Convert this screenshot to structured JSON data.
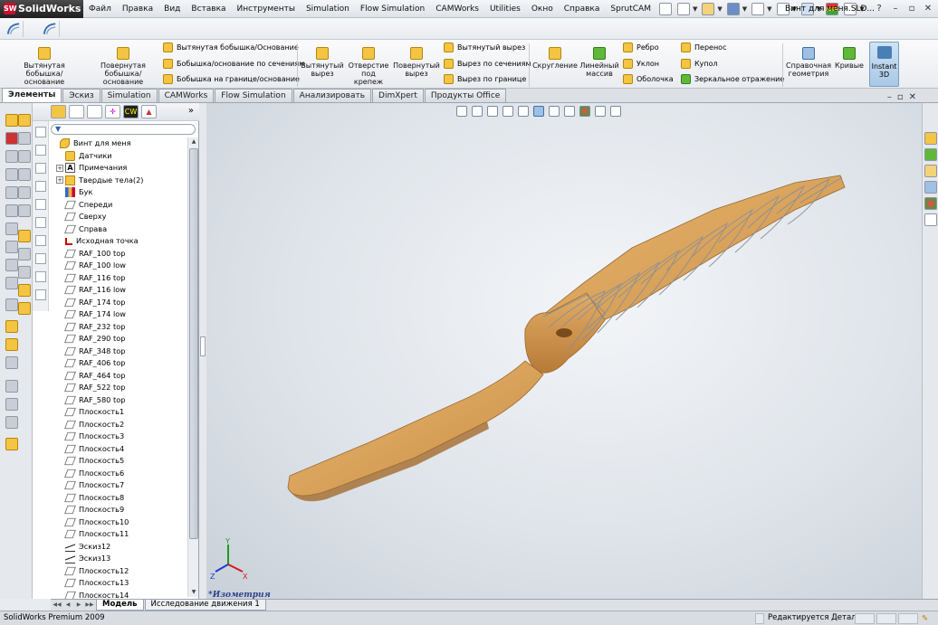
{
  "app": {
    "brand": "SolidWorks",
    "logo_mark": "SW"
  },
  "menu": [
    "Файл",
    "Правка",
    "Вид",
    "Вставка",
    "Инструменты",
    "Simulation",
    "Flow Simulation",
    "CAMWorks",
    "Utilities",
    "Окно",
    "Справка",
    "SprutCAM"
  ],
  "document_title": "Винт для меня.SLD...",
  "ribbon": {
    "boss_extrude": "Вытянутая бобышка/основание",
    "boss_revolve": "Повернутая бобышка/основание",
    "swept_boss": "Вытянутая бобышка/Основание",
    "lofted_boss": "Бобышка/основание по сечениям",
    "boundary_boss": "Бобышка на границе/основание",
    "cut_extrude": "Вытянутый вырез",
    "hole_wizard": "Отверстие под крепеж",
    "cut_revolve": "Повернутый вырез",
    "swept_cut": "Вытянутый вырез",
    "lofted_cut": "Вырез по сечениям",
    "boundary_cut": "Вырез по границе",
    "fillet": "Скругление",
    "linear_pattern": "Линейный массив",
    "rib": "Ребро",
    "draft": "Уклон",
    "shell": "Оболочка",
    "wrap": "Перенос",
    "dome": "Купол",
    "mirror": "Зеркальное отражение",
    "ref_geometry": "Справочная геометрия",
    "curves": "Кривые",
    "instant3d": "Instant 3D"
  },
  "tabs": [
    {
      "label": "Элементы",
      "active": true
    },
    {
      "label": "Эскиз",
      "active": false
    },
    {
      "label": "Simulation",
      "active": false
    },
    {
      "label": "CAMWorks",
      "active": false
    },
    {
      "label": "Flow Simulation",
      "active": false
    },
    {
      "label": "Анализировать",
      "active": false
    },
    {
      "label": "DimXpert",
      "active": false
    },
    {
      "label": "Продукты Office",
      "active": false
    }
  ],
  "feature_tree": [
    {
      "label": "Винт для меня",
      "icon": "part-icon",
      "indent": 0,
      "expand": ""
    },
    {
      "label": "Датчики",
      "icon": "sensor-icon",
      "indent": 1,
      "expand": ""
    },
    {
      "label": "Примечания",
      "icon": "note-icon",
      "indent": 1,
      "expand": "+"
    },
    {
      "label": "Твердые тела(2)",
      "icon": "solid-bodies-icon",
      "indent": 1,
      "expand": "+"
    },
    {
      "label": "Бук",
      "icon": "material-icon",
      "indent": 1,
      "expand": ""
    },
    {
      "label": "Спереди",
      "icon": "plane-icon",
      "indent": 1,
      "expand": ""
    },
    {
      "label": "Сверху",
      "icon": "plane-icon",
      "indent": 1,
      "expand": ""
    },
    {
      "label": "Справа",
      "icon": "plane-icon",
      "indent": 1,
      "expand": ""
    },
    {
      "label": "Исходная точка",
      "icon": "origin-icon",
      "indent": 1,
      "expand": ""
    },
    {
      "label": "RAF_100 top",
      "icon": "plane-icon",
      "indent": 1,
      "expand": ""
    },
    {
      "label": "RAF_100 low",
      "icon": "plane-icon",
      "indent": 1,
      "expand": ""
    },
    {
      "label": "RAF_116 top",
      "icon": "plane-icon",
      "indent": 1,
      "expand": ""
    },
    {
      "label": "RAF_116 low",
      "icon": "plane-icon",
      "indent": 1,
      "expand": ""
    },
    {
      "label": "RAF_174 top",
      "icon": "plane-icon",
      "indent": 1,
      "expand": ""
    },
    {
      "label": "RAF_174 low",
      "icon": "plane-icon",
      "indent": 1,
      "expand": ""
    },
    {
      "label": "RAF_232 top",
      "icon": "plane-icon",
      "indent": 1,
      "expand": ""
    },
    {
      "label": "RAF_290 top",
      "icon": "plane-icon",
      "indent": 1,
      "expand": ""
    },
    {
      "label": "RAF_348 top",
      "icon": "plane-icon",
      "indent": 1,
      "expand": ""
    },
    {
      "label": "RAF_406 top",
      "icon": "plane-icon",
      "indent": 1,
      "expand": ""
    },
    {
      "label": "RAF_464 top",
      "icon": "plane-icon",
      "indent": 1,
      "expand": ""
    },
    {
      "label": "RAF_522 top",
      "icon": "plane-icon",
      "indent": 1,
      "expand": ""
    },
    {
      "label": "RAF_580 top",
      "icon": "plane-icon",
      "indent": 1,
      "expand": ""
    },
    {
      "label": "Плоскость1",
      "icon": "plane-icon",
      "indent": 1,
      "expand": ""
    },
    {
      "label": "Плоскость2",
      "icon": "plane-icon",
      "indent": 1,
      "expand": ""
    },
    {
      "label": "Плоскость3",
      "icon": "plane-icon",
      "indent": 1,
      "expand": ""
    },
    {
      "label": "Плоскость4",
      "icon": "plane-icon",
      "indent": 1,
      "expand": ""
    },
    {
      "label": "Плоскость5",
      "icon": "plane-icon",
      "indent": 1,
      "expand": ""
    },
    {
      "label": "Плоскость6",
      "icon": "plane-icon",
      "indent": 1,
      "expand": ""
    },
    {
      "label": "Плоскость7",
      "icon": "plane-icon",
      "indent": 1,
      "expand": ""
    },
    {
      "label": "Плоскость8",
      "icon": "plane-icon",
      "indent": 1,
      "expand": ""
    },
    {
      "label": "Плоскость9",
      "icon": "plane-icon",
      "indent": 1,
      "expand": ""
    },
    {
      "label": "Плоскость10",
      "icon": "plane-icon",
      "indent": 1,
      "expand": ""
    },
    {
      "label": "Плоскость11",
      "icon": "plane-icon",
      "indent": 1,
      "expand": ""
    },
    {
      "label": "Эскиз12",
      "icon": "sketch-icon",
      "indent": 1,
      "expand": ""
    },
    {
      "label": "Эскиз13",
      "icon": "sketch-icon",
      "indent": 1,
      "expand": ""
    },
    {
      "label": "Плоскость12",
      "icon": "plane-icon",
      "indent": 1,
      "expand": ""
    },
    {
      "label": "Плоскость13",
      "icon": "plane-icon",
      "indent": 1,
      "expand": ""
    },
    {
      "label": "Плоскость14",
      "icon": "plane-icon",
      "indent": 1,
      "expand": ""
    }
  ],
  "viewport": {
    "view_name": "*Изометрия",
    "triad": {
      "x": "X",
      "y": "Y",
      "z": "Z"
    }
  },
  "bottom_tabs": [
    {
      "label": "Модель",
      "active": true
    },
    {
      "label": "Исследование движения 1",
      "active": false
    }
  ],
  "status": {
    "left": "SolidWorks Premium 2009",
    "right": "Редактируется Деталь"
  },
  "colors": {
    "model_wood": "#d9a35c",
    "brand_red": "#c8102e",
    "triad_x": "#d01e1e",
    "triad_y": "#1e9b1e",
    "triad_z": "#1e3cd0"
  }
}
